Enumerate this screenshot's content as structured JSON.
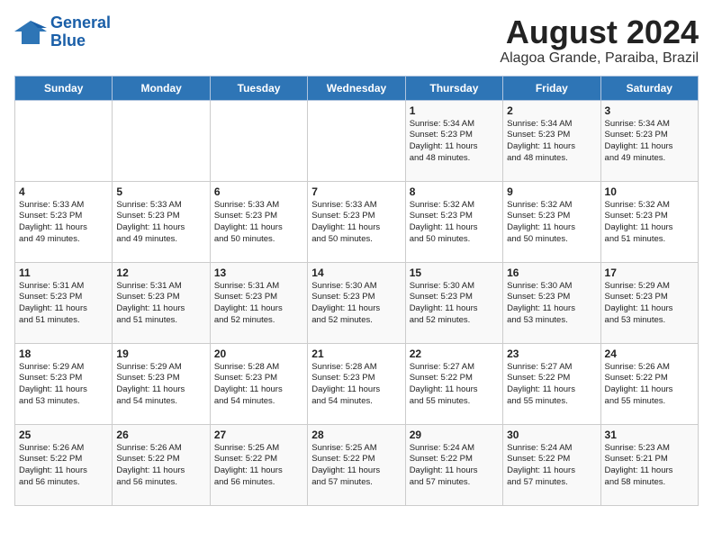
{
  "logo": {
    "line1": "General",
    "line2": "Blue"
  },
  "title": "August 2024",
  "subtitle": "Alagoa Grande, Paraiba, Brazil",
  "days_of_week": [
    "Sunday",
    "Monday",
    "Tuesday",
    "Wednesday",
    "Thursday",
    "Friday",
    "Saturday"
  ],
  "weeks": [
    [
      {
        "day": "",
        "info": ""
      },
      {
        "day": "",
        "info": ""
      },
      {
        "day": "",
        "info": ""
      },
      {
        "day": "",
        "info": ""
      },
      {
        "day": "1",
        "info": "Sunrise: 5:34 AM\nSunset: 5:23 PM\nDaylight: 11 hours\nand 48 minutes."
      },
      {
        "day": "2",
        "info": "Sunrise: 5:34 AM\nSunset: 5:23 PM\nDaylight: 11 hours\nand 48 minutes."
      },
      {
        "day": "3",
        "info": "Sunrise: 5:34 AM\nSunset: 5:23 PM\nDaylight: 11 hours\nand 49 minutes."
      }
    ],
    [
      {
        "day": "4",
        "info": "Sunrise: 5:33 AM\nSunset: 5:23 PM\nDaylight: 11 hours\nand 49 minutes."
      },
      {
        "day": "5",
        "info": "Sunrise: 5:33 AM\nSunset: 5:23 PM\nDaylight: 11 hours\nand 49 minutes."
      },
      {
        "day": "6",
        "info": "Sunrise: 5:33 AM\nSunset: 5:23 PM\nDaylight: 11 hours\nand 50 minutes."
      },
      {
        "day": "7",
        "info": "Sunrise: 5:33 AM\nSunset: 5:23 PM\nDaylight: 11 hours\nand 50 minutes."
      },
      {
        "day": "8",
        "info": "Sunrise: 5:32 AM\nSunset: 5:23 PM\nDaylight: 11 hours\nand 50 minutes."
      },
      {
        "day": "9",
        "info": "Sunrise: 5:32 AM\nSunset: 5:23 PM\nDaylight: 11 hours\nand 50 minutes."
      },
      {
        "day": "10",
        "info": "Sunrise: 5:32 AM\nSunset: 5:23 PM\nDaylight: 11 hours\nand 51 minutes."
      }
    ],
    [
      {
        "day": "11",
        "info": "Sunrise: 5:31 AM\nSunset: 5:23 PM\nDaylight: 11 hours\nand 51 minutes."
      },
      {
        "day": "12",
        "info": "Sunrise: 5:31 AM\nSunset: 5:23 PM\nDaylight: 11 hours\nand 51 minutes."
      },
      {
        "day": "13",
        "info": "Sunrise: 5:31 AM\nSunset: 5:23 PM\nDaylight: 11 hours\nand 52 minutes."
      },
      {
        "day": "14",
        "info": "Sunrise: 5:30 AM\nSunset: 5:23 PM\nDaylight: 11 hours\nand 52 minutes."
      },
      {
        "day": "15",
        "info": "Sunrise: 5:30 AM\nSunset: 5:23 PM\nDaylight: 11 hours\nand 52 minutes."
      },
      {
        "day": "16",
        "info": "Sunrise: 5:30 AM\nSunset: 5:23 PM\nDaylight: 11 hours\nand 53 minutes."
      },
      {
        "day": "17",
        "info": "Sunrise: 5:29 AM\nSunset: 5:23 PM\nDaylight: 11 hours\nand 53 minutes."
      }
    ],
    [
      {
        "day": "18",
        "info": "Sunrise: 5:29 AM\nSunset: 5:23 PM\nDaylight: 11 hours\nand 53 minutes."
      },
      {
        "day": "19",
        "info": "Sunrise: 5:29 AM\nSunset: 5:23 PM\nDaylight: 11 hours\nand 54 minutes."
      },
      {
        "day": "20",
        "info": "Sunrise: 5:28 AM\nSunset: 5:23 PM\nDaylight: 11 hours\nand 54 minutes."
      },
      {
        "day": "21",
        "info": "Sunrise: 5:28 AM\nSunset: 5:23 PM\nDaylight: 11 hours\nand 54 minutes."
      },
      {
        "day": "22",
        "info": "Sunrise: 5:27 AM\nSunset: 5:22 PM\nDaylight: 11 hours\nand 55 minutes."
      },
      {
        "day": "23",
        "info": "Sunrise: 5:27 AM\nSunset: 5:22 PM\nDaylight: 11 hours\nand 55 minutes."
      },
      {
        "day": "24",
        "info": "Sunrise: 5:26 AM\nSunset: 5:22 PM\nDaylight: 11 hours\nand 55 minutes."
      }
    ],
    [
      {
        "day": "25",
        "info": "Sunrise: 5:26 AM\nSunset: 5:22 PM\nDaylight: 11 hours\nand 56 minutes."
      },
      {
        "day": "26",
        "info": "Sunrise: 5:26 AM\nSunset: 5:22 PM\nDaylight: 11 hours\nand 56 minutes."
      },
      {
        "day": "27",
        "info": "Sunrise: 5:25 AM\nSunset: 5:22 PM\nDaylight: 11 hours\nand 56 minutes."
      },
      {
        "day": "28",
        "info": "Sunrise: 5:25 AM\nSunset: 5:22 PM\nDaylight: 11 hours\nand 57 minutes."
      },
      {
        "day": "29",
        "info": "Sunrise: 5:24 AM\nSunset: 5:22 PM\nDaylight: 11 hours\nand 57 minutes."
      },
      {
        "day": "30",
        "info": "Sunrise: 5:24 AM\nSunset: 5:22 PM\nDaylight: 11 hours\nand 57 minutes."
      },
      {
        "day": "31",
        "info": "Sunrise: 5:23 AM\nSunset: 5:21 PM\nDaylight: 11 hours\nand 58 minutes."
      }
    ]
  ]
}
